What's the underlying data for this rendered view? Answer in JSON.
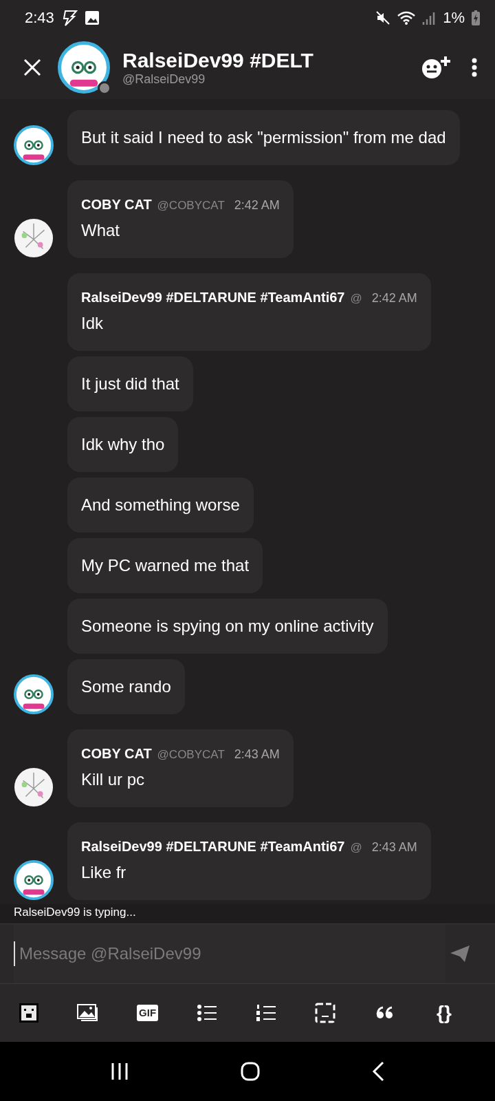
{
  "status_bar": {
    "time": "2:43",
    "battery": "1%"
  },
  "header": {
    "title": "RalseiDev99 #DELT",
    "subtitle": "@RalseiDev99",
    "avatar": {
      "kind": "ralsei",
      "color": "#8a8888"
    }
  },
  "messages": [
    {
      "avatar": {
        "kind": "ralsei"
      },
      "bubbles": [
        "But it said I need to ask \"permission\" from me dad"
      ]
    },
    {
      "avatar": {
        "kind": "coby"
      },
      "author": "COBY CAT",
      "handle": "@COBYCAT",
      "time": "2:42 AM",
      "bubbles": [
        "What"
      ]
    },
    {
      "avatar": {
        "kind": "ralsei"
      },
      "author": "RalseiDev99 #DELTARUNE #TeamAnti67",
      "handle": "@",
      "time": "2:42 AM",
      "bubbles": [
        "Idk",
        "It just did that",
        "Idk why tho",
        "And something worse",
        "My PC warned me that",
        "Someone is spying on my online activity",
        "Some rando"
      ]
    },
    {
      "avatar": {
        "kind": "coby"
      },
      "author": "COBY CAT",
      "handle": "@COBYCAT",
      "time": "2:43 AM",
      "bubbles": [
        "Kill ur pc"
      ]
    },
    {
      "avatar": {
        "kind": "ralsei"
      },
      "author": "RalseiDev99 #DELTARUNE #TeamAnti67",
      "handle": "@",
      "time": "2:43 AM",
      "bubbles": [
        "Like fr"
      ]
    }
  ],
  "typing": "RalseiDev99 is typing...",
  "composer": {
    "placeholder": "Message @RalseiDev99"
  },
  "toolbar": [
    {
      "kind": "sticker"
    },
    {
      "kind": "image"
    },
    {
      "kind": "gif",
      "label": "GIF"
    },
    {
      "kind": "bullets"
    },
    {
      "kind": "numbers"
    },
    {
      "kind": "spoiler"
    },
    {
      "kind": "quote"
    },
    {
      "kind": "code",
      "label": "{}"
    }
  ]
}
